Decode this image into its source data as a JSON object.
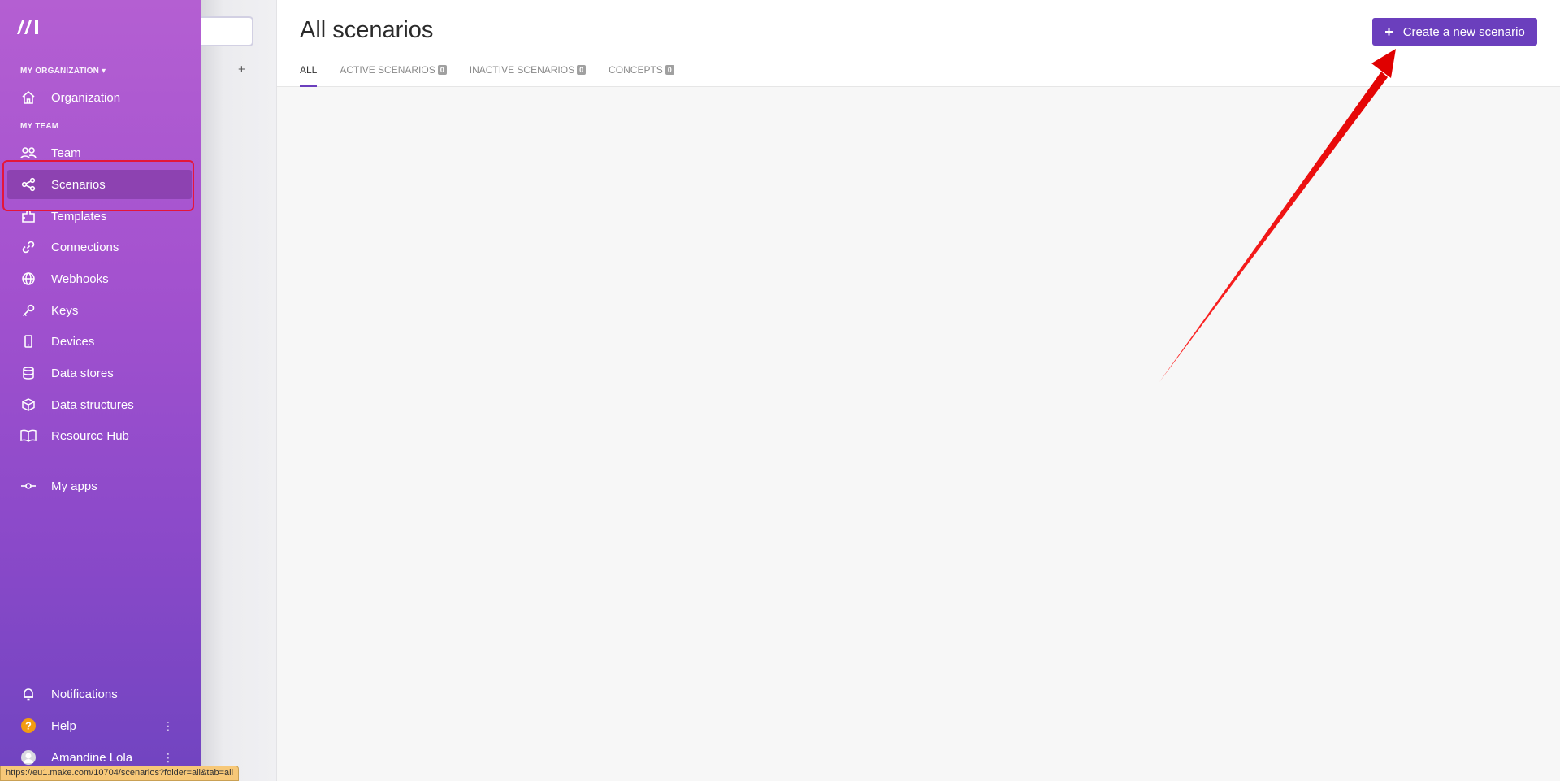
{
  "sidebar": {
    "org_section": "MY ORGANIZATION",
    "team_section": "MY TEAM",
    "items": [
      {
        "label": "Organization",
        "icon": "home-icon"
      },
      {
        "label": "Team",
        "icon": "users-icon"
      },
      {
        "label": "Scenarios",
        "icon": "share-icon"
      },
      {
        "label": "Templates",
        "icon": "puzzle-icon"
      },
      {
        "label": "Connections",
        "icon": "link-icon"
      },
      {
        "label": "Webhooks",
        "icon": "globe-icon"
      },
      {
        "label": "Keys",
        "icon": "key-icon"
      },
      {
        "label": "Devices",
        "icon": "phone-icon"
      },
      {
        "label": "Data stores",
        "icon": "database-icon"
      },
      {
        "label": "Data structures",
        "icon": "cube-icon"
      },
      {
        "label": "Resource Hub",
        "icon": "book-icon"
      },
      {
        "label": "My apps",
        "icon": "commit-icon"
      }
    ],
    "bottom": [
      {
        "label": "Notifications",
        "icon": "bell-icon"
      },
      {
        "label": "Help",
        "icon": "help-icon"
      },
      {
        "label": "Amandine Lola",
        "icon": "avatar-icon"
      }
    ],
    "active": "Scenarios"
  },
  "folders": {
    "add_label": "+"
  },
  "header": {
    "title": "All scenarios",
    "create_button": "Create a new scenario",
    "tabs": [
      {
        "label": "ALL",
        "count": null
      },
      {
        "label": "ACTIVE SCENARIOS",
        "count": "0"
      },
      {
        "label": "INACTIVE SCENARIOS",
        "count": "0"
      },
      {
        "label": "CONCEPTS",
        "count": "0"
      }
    ]
  },
  "statusbar": {
    "url": "https://eu1.make.com/10704/scenarios?folder=all&tab=all"
  },
  "colors": {
    "accent": "#6b3fbd",
    "sidebar_top": "#b45fd2",
    "sidebar_bottom": "#7044c0",
    "annotation": "#e4163a"
  }
}
